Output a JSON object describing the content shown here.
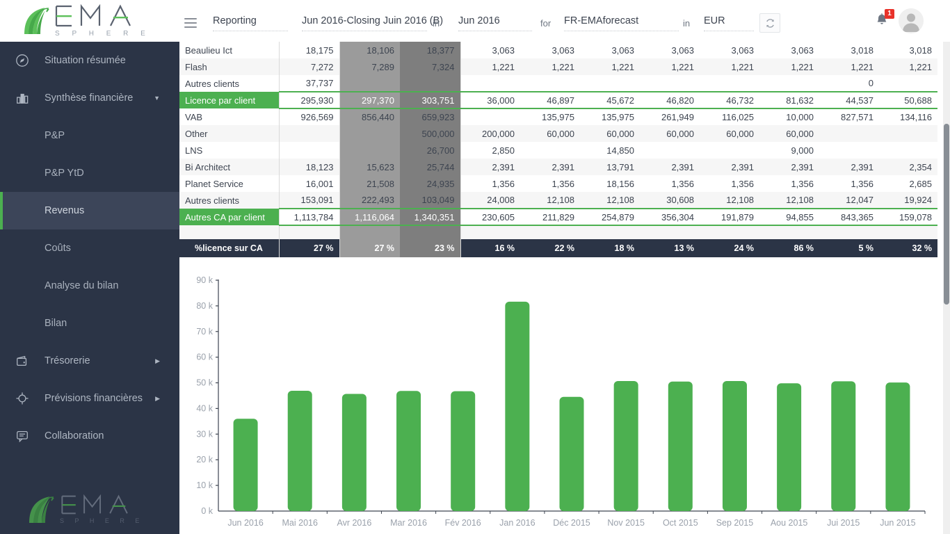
{
  "brand": {
    "name": "EMA",
    "sub": "S P H E R E"
  },
  "header": {
    "menu_icon": "hamburger-icon",
    "module": "Reporting",
    "scenario": "Jun 2016-Closing Juin 2016 (B)",
    "in_label_1": "in",
    "period": "Jun 2016",
    "for_label": "for",
    "entity": "FR-EMAforecast",
    "in_label_2": "in",
    "currency": "EUR",
    "refresh_icon": "refresh-icon",
    "bell_icon": "bell-icon",
    "notification_count": "1",
    "avatar_icon": "user-avatar-icon"
  },
  "sidebar": {
    "items": [
      {
        "label": "Situation résumée",
        "icon": "compass-icon",
        "level": 0,
        "active": false,
        "expandable": false
      },
      {
        "label": "Synthèse financière",
        "icon": "bar-chart-icon",
        "level": 0,
        "active": false,
        "expandable": true,
        "expanded": true
      },
      {
        "label": "P&P",
        "icon": "",
        "level": 1,
        "active": false,
        "expandable": false
      },
      {
        "label": "P&P YtD",
        "icon": "",
        "level": 1,
        "active": false,
        "expandable": false
      },
      {
        "label": "Revenus",
        "icon": "",
        "level": 1,
        "active": true,
        "expandable": false
      },
      {
        "label": "Coûts",
        "icon": "",
        "level": 1,
        "active": false,
        "expandable": false
      },
      {
        "label": "Analyse du bilan",
        "icon": "",
        "level": 1,
        "active": false,
        "expandable": false
      },
      {
        "label": "Bilan",
        "icon": "",
        "level": 1,
        "active": false,
        "expandable": false
      },
      {
        "label": "Trésorerie",
        "icon": "wallet-icon",
        "level": 0,
        "active": false,
        "expandable": true,
        "expanded": false
      },
      {
        "label": "Prévisions financières",
        "icon": "target-icon",
        "level": 0,
        "active": false,
        "expandable": true,
        "expanded": false
      },
      {
        "label": "Collaboration",
        "icon": "chat-icon",
        "level": 0,
        "active": false,
        "expandable": false
      }
    ]
  },
  "table": {
    "rows": [
      {
        "kind": "data",
        "label": "Beaulieu Ict",
        "values": [
          "18,175",
          "18,106",
          "18,377",
          "3,063",
          "3,063",
          "3,063",
          "3,063",
          "3,063",
          "3,063",
          "3,018",
          "3,018"
        ]
      },
      {
        "kind": "data",
        "label": "Flash",
        "values": [
          "7,272",
          "7,289",
          "7,324",
          "1,221",
          "1,221",
          "1,221",
          "1,221",
          "1,221",
          "1,221",
          "1,221",
          "1,221"
        ]
      },
      {
        "kind": "data",
        "label": "Autres clients",
        "values": [
          "37,737",
          "",
          "",
          "",
          "",
          "",
          "",
          "",
          "",
          "0",
          ""
        ]
      },
      {
        "kind": "total",
        "label": "Licence par client",
        "values": [
          "295,930",
          "297,370",
          "303,751",
          "36,000",
          "46,897",
          "45,672",
          "46,820",
          "46,732",
          "81,632",
          "44,537",
          "50,688"
        ]
      },
      {
        "kind": "data",
        "label": "VAB",
        "values": [
          "926,569",
          "856,440",
          "659,923",
          "",
          "135,975",
          "135,975",
          "261,949",
          "116,025",
          "10,000",
          "827,571",
          "134,116"
        ]
      },
      {
        "kind": "data",
        "label": "Other",
        "values": [
          "",
          "",
          "500,000",
          "200,000",
          "60,000",
          "60,000",
          "60,000",
          "60,000",
          "60,000",
          "",
          ""
        ]
      },
      {
        "kind": "data",
        "label": "LNS",
        "values": [
          "",
          "",
          "26,700",
          "2,850",
          "",
          "14,850",
          "",
          "",
          "9,000",
          "",
          ""
        ]
      },
      {
        "kind": "data",
        "label": "Bi Architect",
        "values": [
          "18,123",
          "15,623",
          "25,744",
          "2,391",
          "2,391",
          "13,791",
          "2,391",
          "2,391",
          "2,391",
          "2,391",
          "2,354"
        ]
      },
      {
        "kind": "data",
        "label": "Planet Service",
        "values": [
          "16,001",
          "21,508",
          "24,935",
          "1,356",
          "1,356",
          "18,156",
          "1,356",
          "1,356",
          "1,356",
          "1,356",
          "2,685"
        ]
      },
      {
        "kind": "data",
        "label": "Autres clients",
        "values": [
          "153,091",
          "222,493",
          "103,049",
          "24,008",
          "12,108",
          "12,108",
          "30,608",
          "12,108",
          "12,108",
          "12,047",
          "19,924"
        ]
      },
      {
        "kind": "total",
        "label": "Autres CA par client",
        "values": [
          "1,113,784",
          "1,116,064",
          "1,340,351",
          "230,605",
          "211,829",
          "254,879",
          "356,304",
          "191,879",
          "94,855",
          "843,365",
          "159,078"
        ]
      },
      {
        "kind": "spacer",
        "label": "",
        "values": [
          "",
          "",
          "",
          "",
          "",
          "",
          "",
          "",
          "",
          "",
          ""
        ]
      },
      {
        "kind": "pct",
        "label": "%licence sur CA",
        "values": [
          "27 %",
          "27 %",
          "23 %",
          "16 %",
          "22 %",
          "18 %",
          "13 %",
          "24 %",
          "86 %",
          "5 %",
          "32 %"
        ]
      }
    ]
  },
  "chart_data": {
    "type": "bar",
    "title": "",
    "xlabel": "",
    "ylabel": "",
    "ylim": [
      0,
      90000
    ],
    "grid": false,
    "legend": "none",
    "bar_color": "#4cb050",
    "ytick_labels": [
      "90 k",
      "80 k",
      "70 k",
      "60 k",
      "50 k",
      "40 k",
      "30 k",
      "20 k",
      "10 k",
      "0 k"
    ],
    "ytick_values": [
      90000,
      80000,
      70000,
      60000,
      50000,
      40000,
      30000,
      20000,
      10000,
      0
    ],
    "categories": [
      "Jun 2016",
      "Mai 2016",
      "Avr 2016",
      "Mar 2016",
      "Fév 2016",
      "Jan 2016",
      "Déc 2015",
      "Nov 2015",
      "Oct 2015",
      "Sep 2015",
      "Aou 2015",
      "Jui 2015",
      "Jun 2015"
    ],
    "values": [
      36000,
      46897,
      45672,
      46820,
      46732,
      81632,
      44537,
      50688,
      50500,
      50700,
      49800,
      50600,
      50100
    ]
  },
  "scrollbar": {
    "name": "vertical-scrollbar"
  }
}
